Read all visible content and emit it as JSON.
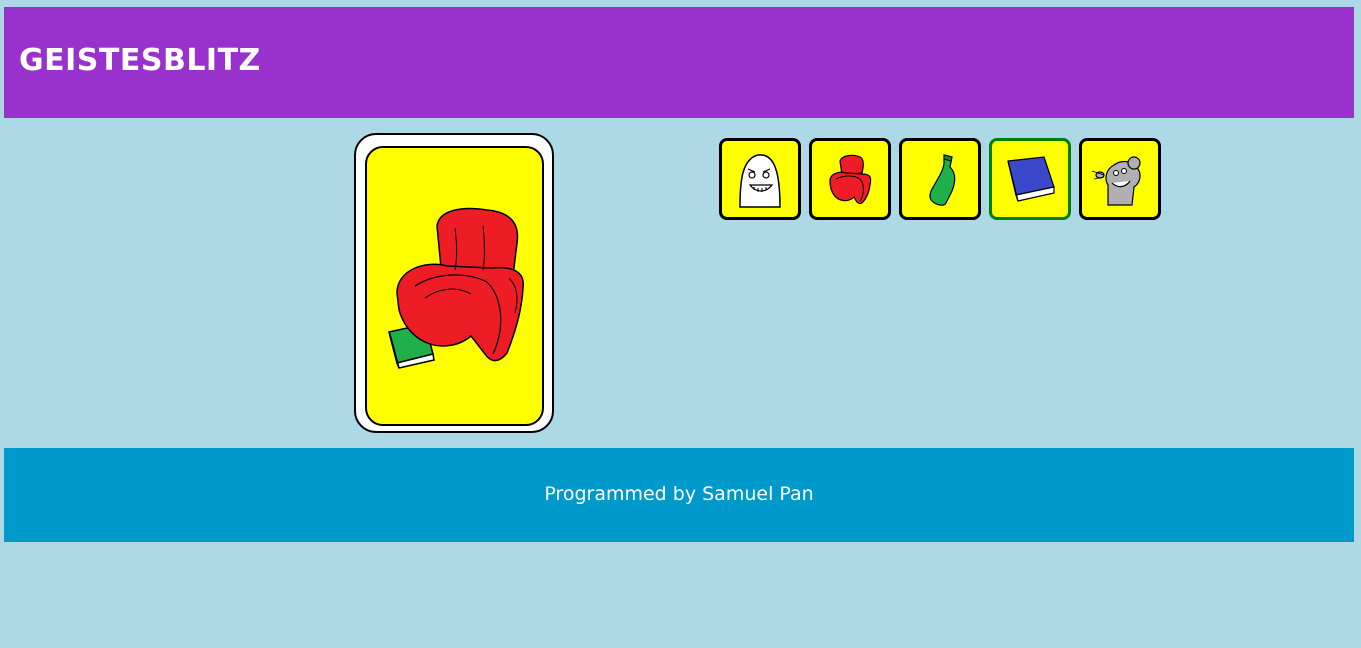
{
  "header": {
    "title": "GEISTESBLITZ"
  },
  "card": {
    "items": [
      "red-armchair-icon",
      "green-book-icon"
    ],
    "background_color": "#ffff00"
  },
  "choices": [
    {
      "name": "ghost",
      "icon": "white-ghost-icon",
      "selected": false
    },
    {
      "name": "armchair",
      "icon": "red-armchair-icon",
      "selected": false
    },
    {
      "name": "bottle",
      "icon": "green-bottle-icon",
      "selected": false
    },
    {
      "name": "book",
      "icon": "blue-book-icon",
      "selected": true
    },
    {
      "name": "mouse",
      "icon": "grey-mouse-icon",
      "selected": false
    }
  ],
  "footer": {
    "credit": "Programmed by Samuel Pan"
  },
  "colors": {
    "header": "#9932cc",
    "footer": "#0099cc",
    "background": "#add8e6",
    "card_face": "#ffff00",
    "selected_border": "#008000"
  }
}
